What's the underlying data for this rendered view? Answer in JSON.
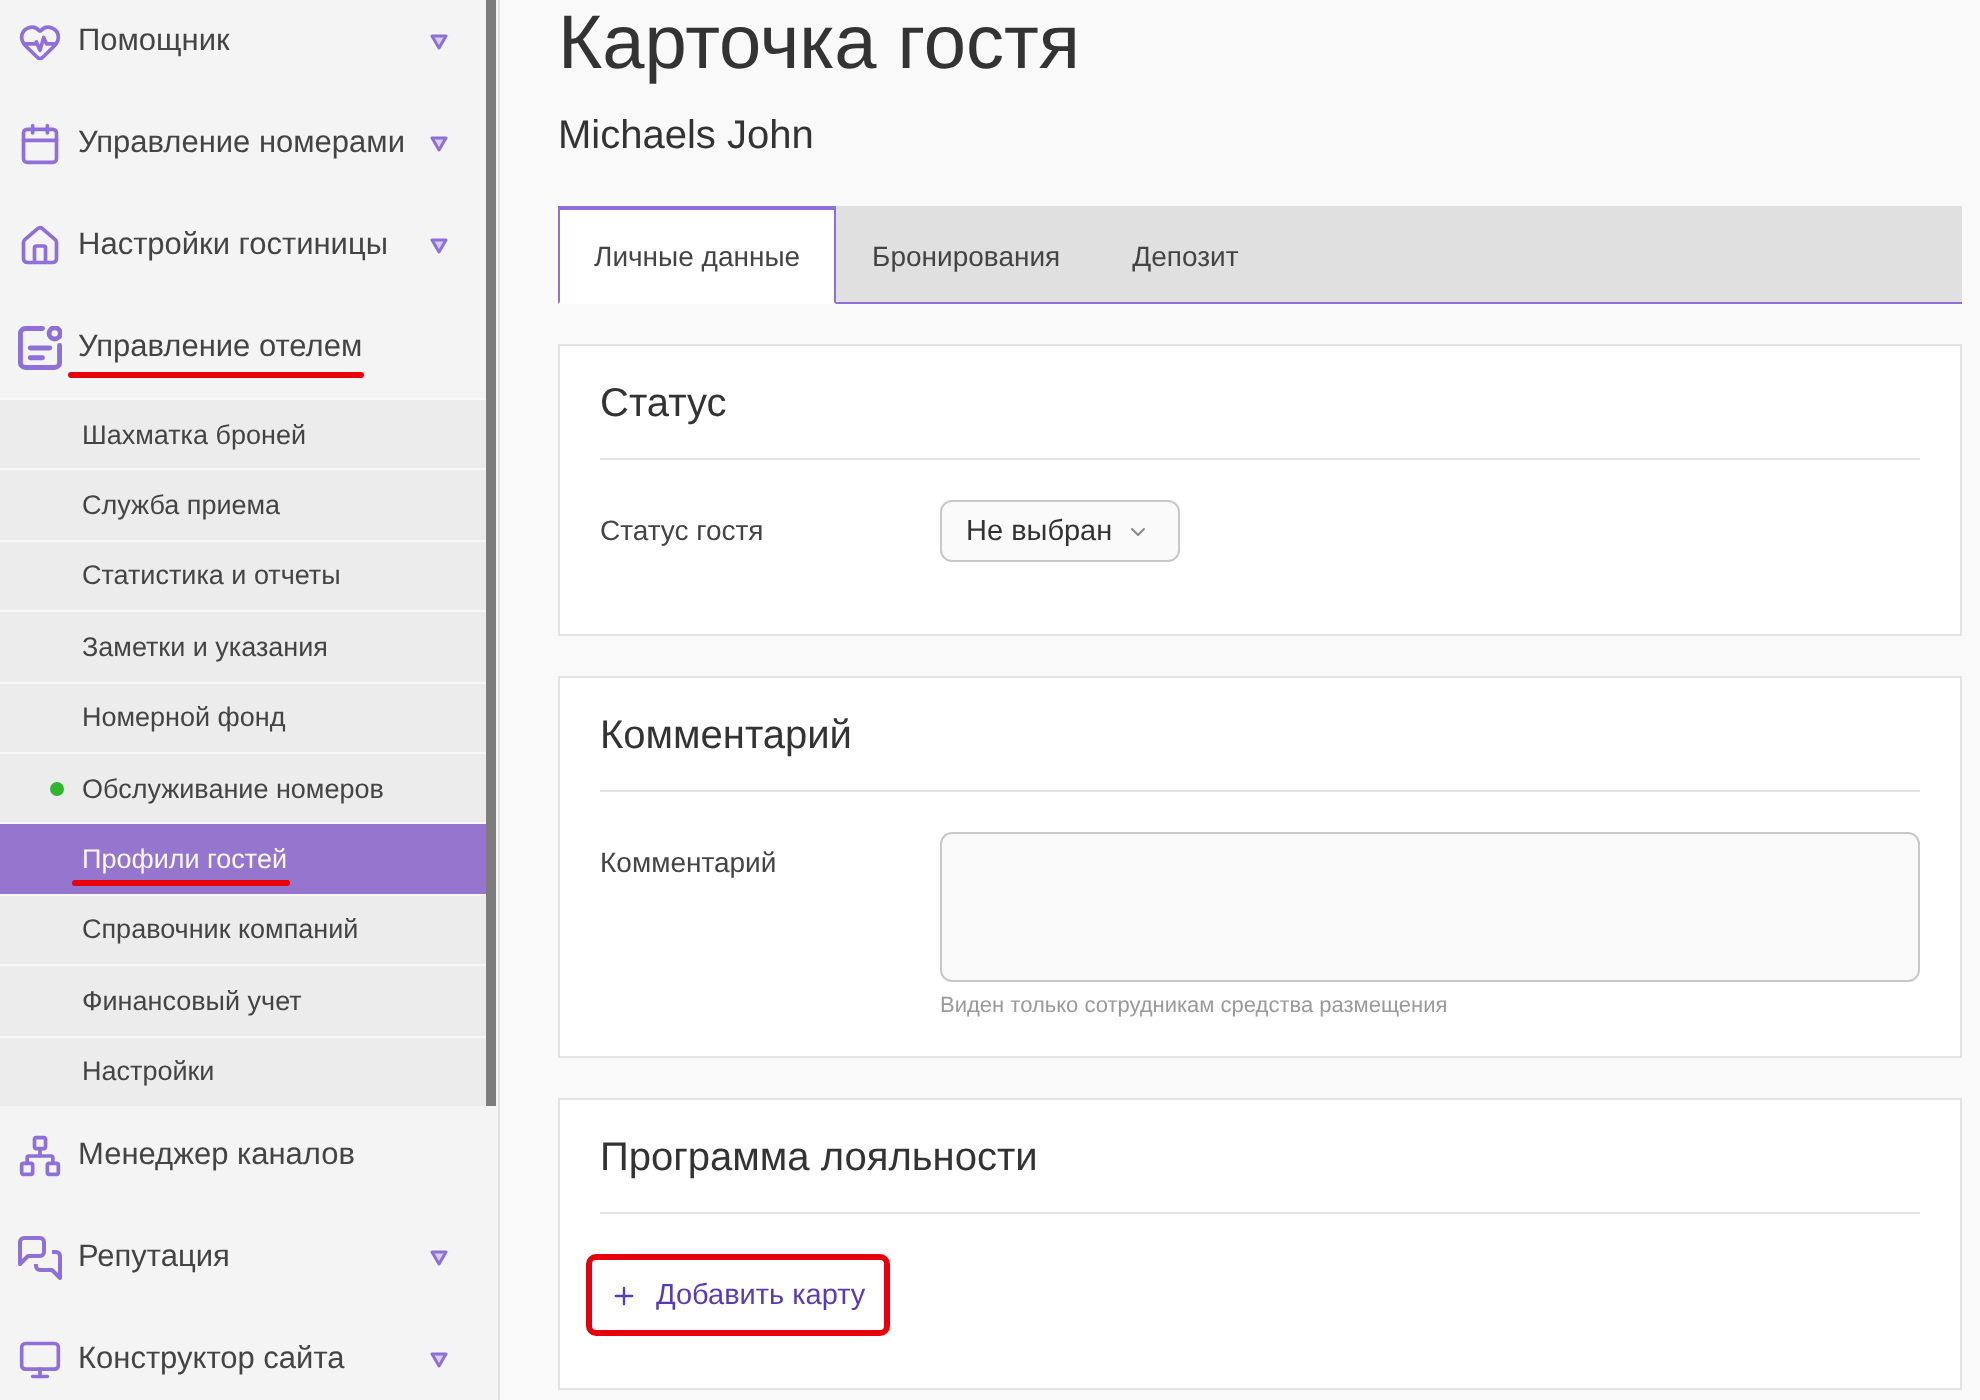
{
  "sidebar": {
    "items": [
      {
        "label": "Помощник",
        "expandable": true,
        "expanded": false,
        "annotated": false
      },
      {
        "label": "Управление номерами",
        "expandable": true,
        "expanded": false,
        "annotated": false
      },
      {
        "label": "Настройки гостиницы",
        "expandable": true,
        "expanded": false,
        "annotated": false
      },
      {
        "label": "Управление отелем",
        "expandable": true,
        "expanded": true,
        "annotated": true,
        "children": [
          {
            "label": "Шахматка броней",
            "selected": false,
            "dot": false,
            "annotated": false
          },
          {
            "label": "Служба приема",
            "selected": false,
            "dot": false,
            "annotated": false
          },
          {
            "label": "Статистика и отчеты",
            "selected": false,
            "dot": false,
            "annotated": false
          },
          {
            "label": "Заметки и указания",
            "selected": false,
            "dot": false,
            "annotated": false
          },
          {
            "label": "Номерной фонд",
            "selected": false,
            "dot": false,
            "annotated": false
          },
          {
            "label": "Обслуживание номеров",
            "selected": false,
            "dot": true,
            "annotated": false
          },
          {
            "label": "Профили гостей",
            "selected": true,
            "dot": false,
            "annotated": true
          },
          {
            "label": "Справочник компаний",
            "selected": false,
            "dot": false,
            "annotated": false
          },
          {
            "label": "Финансовый учет",
            "selected": false,
            "dot": false,
            "annotated": false
          },
          {
            "label": "Настройки",
            "selected": false,
            "dot": false,
            "annotated": false
          }
        ]
      },
      {
        "label": "Менеджер каналов",
        "expandable": false,
        "annotated": false
      },
      {
        "label": "Репутация",
        "expandable": true,
        "expanded": false,
        "annotated": false
      },
      {
        "label": "Конструктор сайта",
        "expandable": true,
        "expanded": false,
        "annotated": false
      }
    ]
  },
  "page": {
    "title": "Карточка гостя",
    "guest_name": "Michaels John"
  },
  "tabs": [
    {
      "label": "Личные данные",
      "selected": true
    },
    {
      "label": "Бронирования",
      "selected": false
    },
    {
      "label": "Депозит",
      "selected": false
    }
  ],
  "sections": [
    {
      "title": "Статус",
      "fields": [
        {
          "kind": "select",
          "label": "Статус гостя",
          "value": "Не выбран"
        }
      ]
    },
    {
      "title": "Комментарий",
      "fields": [
        {
          "kind": "textarea",
          "label": "Комментарий",
          "hint": "Виден только сотрудникам средства размещения"
        }
      ]
    },
    {
      "title": "Программа лояльности",
      "actions": [
        {
          "kind": "add",
          "label": "Добавить карту",
          "annotated": true
        }
      ]
    }
  ]
}
